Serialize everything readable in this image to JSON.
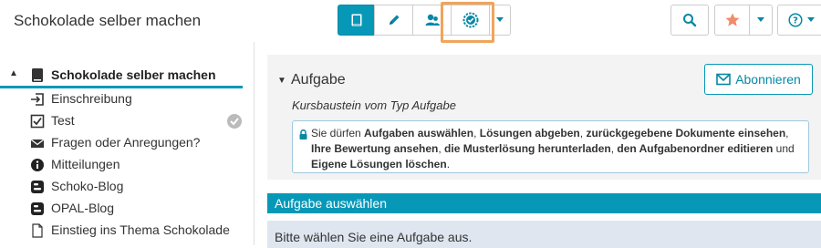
{
  "header": {
    "title": "Schokolade selber machen",
    "toolbar": [
      {
        "name": "course-view",
        "icon": "book-icon",
        "active": true
      },
      {
        "name": "edit",
        "icon": "pencil-icon",
        "active": false
      },
      {
        "name": "participants",
        "icon": "users-icon",
        "active": false
      },
      {
        "name": "assessment",
        "icon": "badge-check-icon",
        "active": false
      },
      {
        "name": "more",
        "icon": "caret-down-icon",
        "active": false
      }
    ],
    "right_tools": [
      "search-icon",
      "star-icon",
      "caret-down-icon",
      "help-icon",
      "caret-down-icon"
    ]
  },
  "sidebar": {
    "root": {
      "label": "Schokolade selber machen",
      "icon": "book-icon",
      "expanded": true
    },
    "items": [
      {
        "label": "Einschreibung",
        "icon": "enrollment-icon",
        "status": ""
      },
      {
        "label": "Test",
        "icon": "checkbox-icon",
        "status": "done"
      },
      {
        "label": "Fragen oder Anregungen?",
        "icon": "envelope-icon",
        "status": ""
      },
      {
        "label": "Mitteilungen",
        "icon": "info-icon",
        "status": ""
      },
      {
        "label": "Schoko-Blog",
        "icon": "blog-icon",
        "status": ""
      },
      {
        "label": "OPAL-Blog",
        "icon": "blog-icon",
        "status": ""
      },
      {
        "label": "Einstieg ins Thema Schokolade",
        "icon": "page-icon",
        "status": ""
      }
    ]
  },
  "main": {
    "title": "Aufgabe",
    "subscribe_label": "Abonnieren",
    "subtitle": "Kursbaustein vom Typ Aufgabe",
    "permissions": {
      "t1": "Sie dürfen ",
      "b1": "Aufgaben auswählen",
      "t2": ", ",
      "b2": "Lösungen abgeben",
      "t3": ", ",
      "b3": "zurückgegebene Dokumente einsehen",
      "t4": ", ",
      "b4": "Ihre Bewertung ansehen",
      "t5": ", ",
      "b5": "die Musterlösung herunterladen",
      "t6": ", ",
      "b6": "den Aufgabenordner editieren",
      "t7": " und ",
      "b7": "Eigene Lösungen löschen",
      "t8": "."
    },
    "section_title": "Aufgabe auswählen",
    "info_text": "Bitte wählen Sie eine Aufgabe aus."
  },
  "colors": {
    "accent": "#0798b8",
    "highlight": "#f0a45c",
    "star": "#f08c6a",
    "info_row": "#dfe6ef",
    "panel": "#f3f3f3"
  }
}
